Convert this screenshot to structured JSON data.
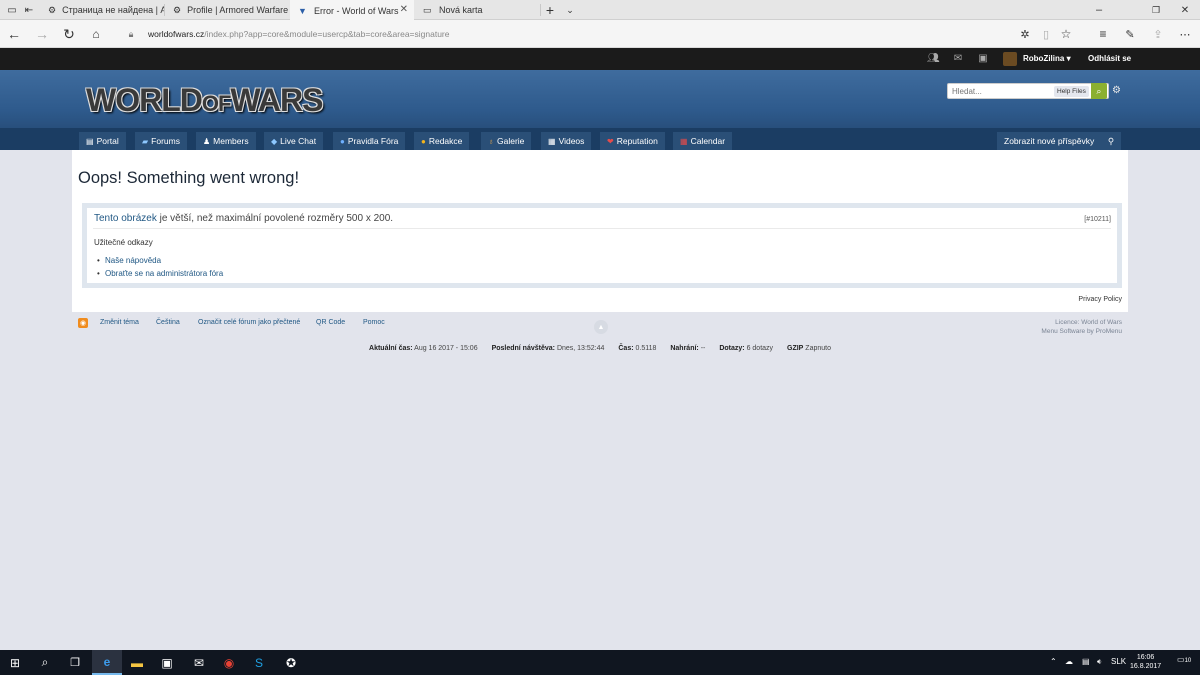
{
  "browser": {
    "tabs": [
      {
        "title": "Страница не найдена | Arm",
        "icon": "armored-warfare-icon",
        "active": false
      },
      {
        "title": "Profile | Armored Warfare -",
        "icon": "armored-warfare-icon",
        "active": false
      },
      {
        "title": "Error - World of Wars",
        "icon": "world-of-wars-icon",
        "active": true
      },
      {
        "title": "Nová karta",
        "icon": "new-tab-page-icon",
        "active": false
      }
    ],
    "url_host": "worldofwars.cz",
    "url_path": "/index.php?app=core&module=usercp&tab=core&area=signature"
  },
  "userbar": {
    "username": "RoboZilina",
    "logout": "Odhlásit se"
  },
  "branding": {
    "logo_text_1": "WORLD",
    "logo_text_of": "OF",
    "logo_text_2": "WARS"
  },
  "search": {
    "placeholder": "Hledat...",
    "scope": "Help Files"
  },
  "primary_nav": {
    "items": [
      {
        "label": "Portal",
        "icon": "portal-icon"
      },
      {
        "label": "Forums",
        "icon": "forums-icon"
      },
      {
        "label": "Members",
        "icon": "members-icon"
      },
      {
        "label": "Live Chat",
        "icon": "chat-icon"
      },
      {
        "label": "Pravidla Fóra",
        "icon": "info-icon"
      },
      {
        "label": "Redakce",
        "icon": "smiley-icon"
      },
      {
        "label": "Galerie",
        "icon": "gallery-icon"
      },
      {
        "label": "Videos",
        "icon": "videos-icon"
      },
      {
        "label": "Reputation",
        "icon": "reputation-icon"
      },
      {
        "label": "Calendar",
        "icon": "calendar-icon"
      }
    ],
    "new_posts": "Zobrazit nové příspěvky"
  },
  "main": {
    "title": "Oops! Something went wrong!",
    "error_link": "Tento obrázek",
    "error_text": " je větší, než maximální povolené rozměry 500 x 200.",
    "error_code": "[#10211]",
    "useful_links_title": "Užitečné odkazy",
    "useful_links": [
      "Naše nápověda",
      "Obraťte se na administrátora fóra"
    ],
    "privacy": "Privacy Policy"
  },
  "footer": {
    "links": [
      "Změnit téma",
      "Čeština",
      "Označit celé fórum jako přečtené",
      "QR Code",
      "Pomoc"
    ],
    "licence": "Licence: World of Wars",
    "software": "Menu Software by ProMenu"
  },
  "stats": {
    "current_time_label": "Aktuální čas:",
    "current_time": "Aug 16 2017 - 15:06",
    "last_visit_label": "Poslední návštěva:",
    "last_visit": "Dnes, 13:52:44",
    "time_label": "Čas:",
    "time": "0.5118",
    "loads_label": "Nahrání:",
    "loads": "--",
    "queries_label": "Dotazy:",
    "queries": "6 dotazy",
    "gzip_label": "GZIP",
    "gzip": "Zapnuto"
  },
  "taskbar": {
    "language": "SLK",
    "time": "16:06",
    "date": "16.8.2017",
    "notifications": "10"
  }
}
